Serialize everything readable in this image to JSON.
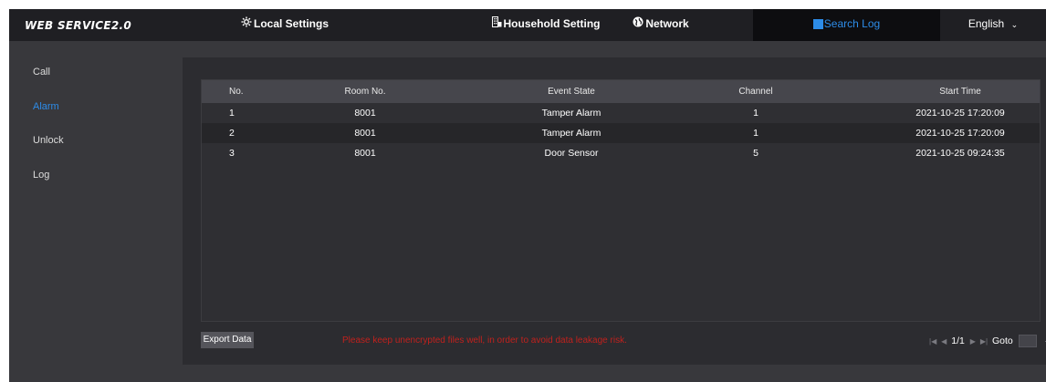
{
  "app": {
    "logo": "WEB SERVICE2.0"
  },
  "nav": {
    "local_settings": "Local Settings",
    "household_setting": "Household Setting",
    "network": "Network",
    "search_log": "Search Log",
    "language": "English",
    "active": "Search Log"
  },
  "sidebar": {
    "items": [
      {
        "label": "Call"
      },
      {
        "label": "Alarm",
        "active": true
      },
      {
        "label": "Unlock"
      },
      {
        "label": "Log"
      }
    ]
  },
  "table": {
    "headers": {
      "no": "No.",
      "room": "Room No.",
      "event": "Event State",
      "channel": "Channel",
      "start": "Start Time"
    },
    "rows": [
      {
        "no": "1",
        "room": "8001",
        "event": "Tamper Alarm",
        "channel": "1",
        "start": "2021-10-25 17:20:09"
      },
      {
        "no": "2",
        "room": "8001",
        "event": "Tamper Alarm",
        "channel": "1",
        "start": "2021-10-25 17:20:09"
      },
      {
        "no": "3",
        "room": "8001",
        "event": "Door Sensor",
        "channel": "5",
        "start": "2021-10-25 09:24:35"
      }
    ]
  },
  "footer": {
    "export_label": "Export Data",
    "warning": "Please keep unencrypted files well, in order to avoid data leakage risk.",
    "page_indicator": "1/1",
    "goto_label": "Goto"
  },
  "colors": {
    "accent": "#2d8ce8",
    "warning": "#c0211d",
    "background": "#38383c",
    "topbar": "#1f1f23"
  }
}
